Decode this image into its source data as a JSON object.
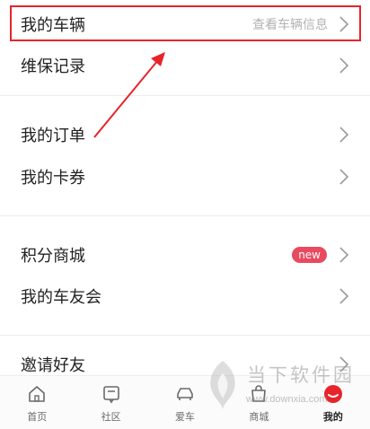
{
  "menu": {
    "my_vehicle": {
      "label": "我的车辆",
      "hint": "查看车辆信息"
    },
    "maintenance": {
      "label": "维保记录"
    },
    "my_orders": {
      "label": "我的订单"
    },
    "my_coupons": {
      "label": "我的卡券"
    },
    "points_mall": {
      "label": "积分商城",
      "badge": "new"
    },
    "car_club": {
      "label": "我的车友会"
    },
    "invite_friends": {
      "label": "邀请好友"
    }
  },
  "tabbar": [
    {
      "label": "首页",
      "icon": "home-icon"
    },
    {
      "label": "社区",
      "icon": "community-icon"
    },
    {
      "label": "爱车",
      "icon": "car-icon"
    },
    {
      "label": "商城",
      "icon": "mall-icon"
    },
    {
      "label": "我的",
      "icon": "profile-icon",
      "active": true
    }
  ],
  "watermark": {
    "text": "当下软件园",
    "url": "www.downxia.com"
  },
  "colors": {
    "accent": "#e84a5f",
    "annotation": "#e8232a",
    "hint": "#b3b3b3"
  }
}
